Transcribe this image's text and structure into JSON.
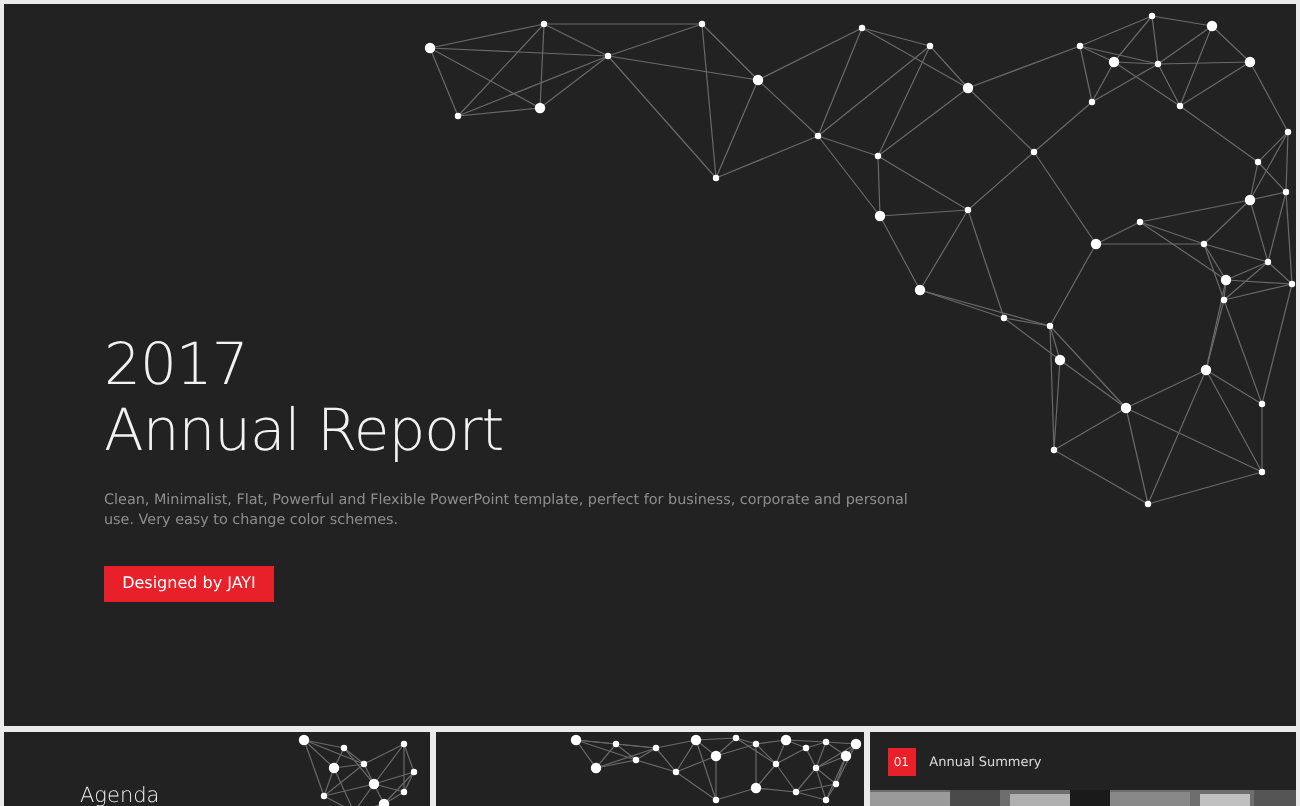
{
  "slide": {
    "year": "2017",
    "title": "Annual Report",
    "description": "Clean, Minimalist, Flat, Powerful and Flexible PowerPoint template, perfect for business, corporate and personal use. Very easy to change color schemes.",
    "button": "Designed by JAYI"
  },
  "thumbnails": [
    {
      "kind": "agenda",
      "title": "Agenda"
    },
    {
      "kind": "network"
    },
    {
      "kind": "section",
      "number": "01",
      "title": "Annual Summery"
    }
  ]
}
